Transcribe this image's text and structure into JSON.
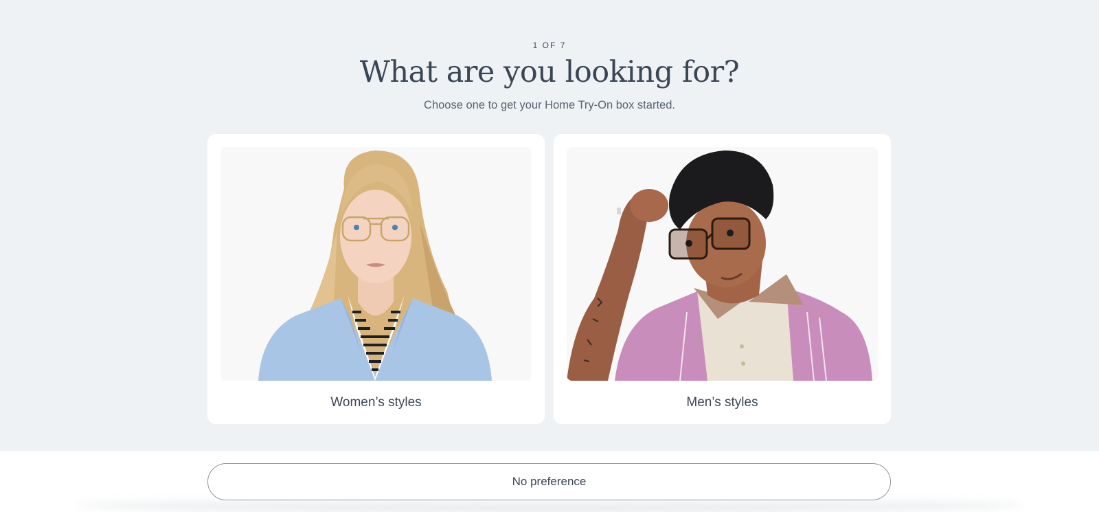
{
  "step": {
    "text": "1 OF 7"
  },
  "header": {
    "title": "What are you looking for?",
    "subtitle": "Choose one to get your Home Try-On box started."
  },
  "options": [
    {
      "label": "Women’s styles"
    },
    {
      "label": "Men’s styles"
    }
  ],
  "footer": {
    "no_preference_label": "No preference"
  }
}
